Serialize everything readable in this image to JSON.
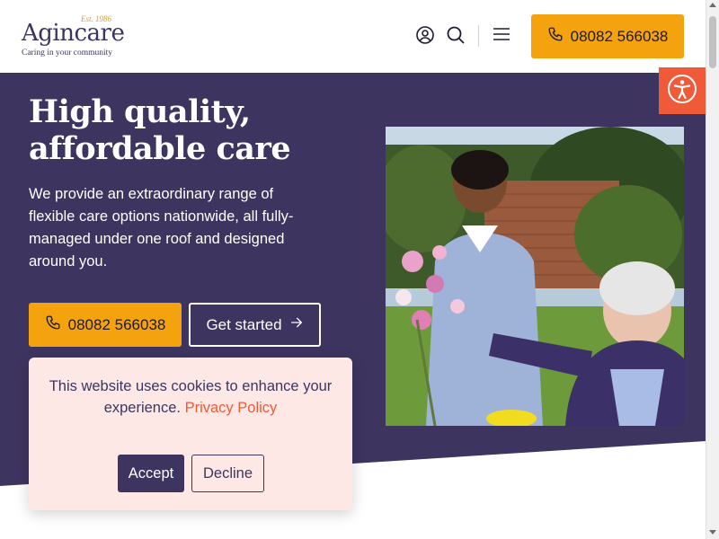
{
  "header": {
    "logo_est": "Est. 1986",
    "logo_name": "Agincare",
    "logo_tagline": "Caring in your community",
    "account_icon": "user-circle-icon",
    "search_icon": "search-icon",
    "menu_icon": "hamburger-menu-icon",
    "phone_label": "08082 566038"
  },
  "hero": {
    "title_line1": "High quality,",
    "title_line2": "affordable care",
    "description": "We provide an extraordinary range of flexible care options nationwide, all fully-managed under one roof and designed around you.",
    "phone_label": "08082 566038",
    "get_started_label": "Get started"
  },
  "accessibility": {
    "icon": "accessibility-person-icon"
  },
  "cookie": {
    "message": "This website uses cookies to enhance your experience.",
    "privacy_link": "Privacy Policy",
    "accept_label": "Accept",
    "decline_label": "Decline"
  },
  "colors": {
    "brand_purple": "#3d3560",
    "accent_orange": "#f4a20d",
    "accessibility_red": "#ef5b38",
    "cookie_bg": "#fde8e5"
  }
}
